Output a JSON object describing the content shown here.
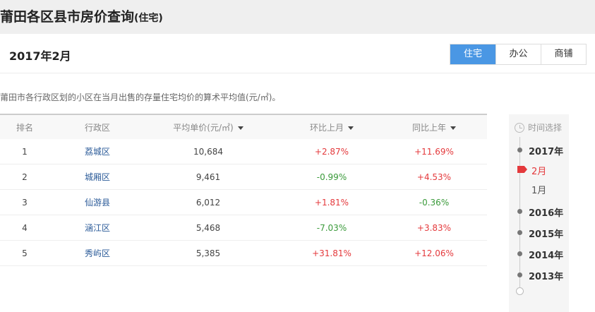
{
  "header": {
    "title": "莆田各区县市房价查询",
    "subtitle": "(住宅)"
  },
  "period": "2017年2月",
  "tabs": [
    {
      "label": "住宅",
      "active": true
    },
    {
      "label": "办公",
      "active": false
    },
    {
      "label": "商铺",
      "active": false
    }
  ],
  "description": "莆田市各行政区划的小区在当月出售的存量住宅均价的算术平均值(元/㎡)。",
  "table": {
    "headers": {
      "rank": "排名",
      "district": "行政区",
      "price": "平均单价(元/㎡)",
      "mom": "环比上月",
      "yoy": "同比上年"
    },
    "rows": [
      {
        "rank": "1",
        "district": "荔城区",
        "price": "10,684",
        "mom": "+2.87%",
        "yoy": "+11.69%"
      },
      {
        "rank": "2",
        "district": "城厢区",
        "price": "9,461",
        "mom": "-0.99%",
        "yoy": "+4.53%"
      },
      {
        "rank": "3",
        "district": "仙游县",
        "price": "6,012",
        "mom": "+1.81%",
        "yoy": "-0.36%"
      },
      {
        "rank": "4",
        "district": "涵江区",
        "price": "5,468",
        "mom": "-7.03%",
        "yoy": "+3.83%"
      },
      {
        "rank": "5",
        "district": "秀屿区",
        "price": "5,385",
        "mom": "+31.81%",
        "yoy": "+12.06%"
      }
    ]
  },
  "timeline": {
    "heading": "时间选择",
    "items": [
      {
        "label": "2017年",
        "kind": "year"
      },
      {
        "label": "2月",
        "kind": "month",
        "selected": true
      },
      {
        "label": "1月",
        "kind": "month"
      },
      {
        "label": "2016年",
        "kind": "year"
      },
      {
        "label": "2015年",
        "kind": "year"
      },
      {
        "label": "2014年",
        "kind": "year"
      },
      {
        "label": "2013年",
        "kind": "year"
      }
    ]
  },
  "colors": {
    "accent": "#4a97e4",
    "up": "#e4393c",
    "down": "#3a9a3a",
    "link": "#2a5a98"
  },
  "icons": {
    "timeline": "clock-icon",
    "sort": "caret-down-icon"
  }
}
